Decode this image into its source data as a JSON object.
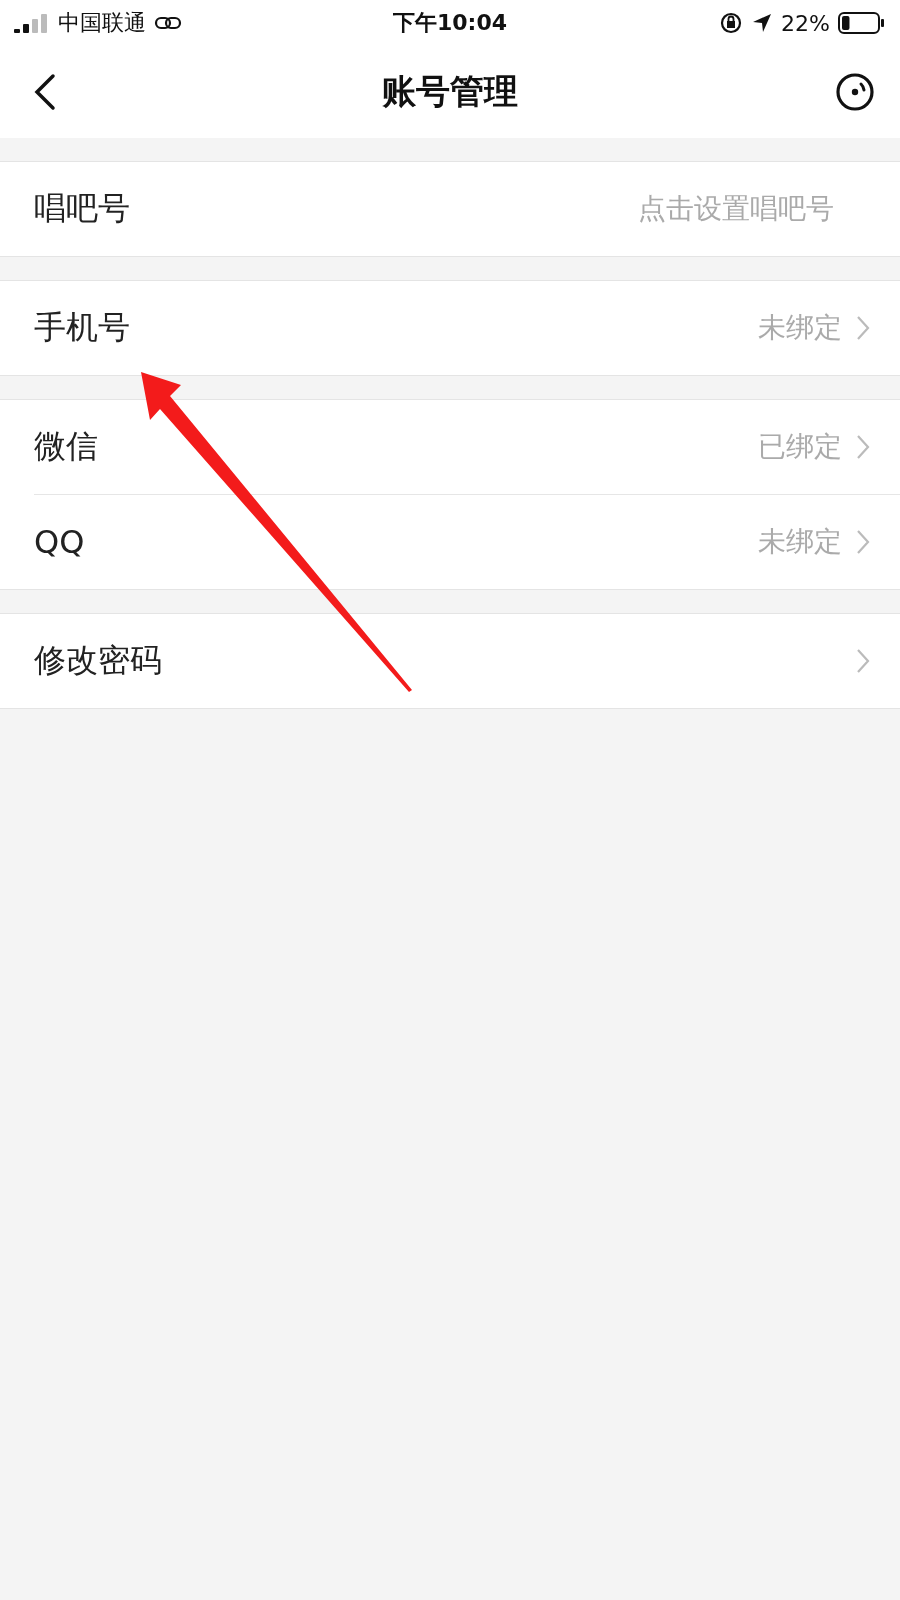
{
  "status_bar": {
    "carrier": "中国联通",
    "time": "下午10:04",
    "battery": "22%"
  },
  "nav": {
    "title": "账号管理"
  },
  "sections": [
    [
      {
        "label": "唱吧号",
        "value": "点击设置唱吧号",
        "has_chevron": false
      }
    ],
    [
      {
        "label": "手机号",
        "value": "未绑定",
        "has_chevron": true
      }
    ],
    [
      {
        "label": "微信",
        "value": "已绑定",
        "has_chevron": true
      },
      {
        "label": "QQ",
        "value": "未绑定",
        "has_chevron": true
      }
    ],
    [
      {
        "label": "修改密码",
        "has_chevron": true
      }
    ]
  ]
}
